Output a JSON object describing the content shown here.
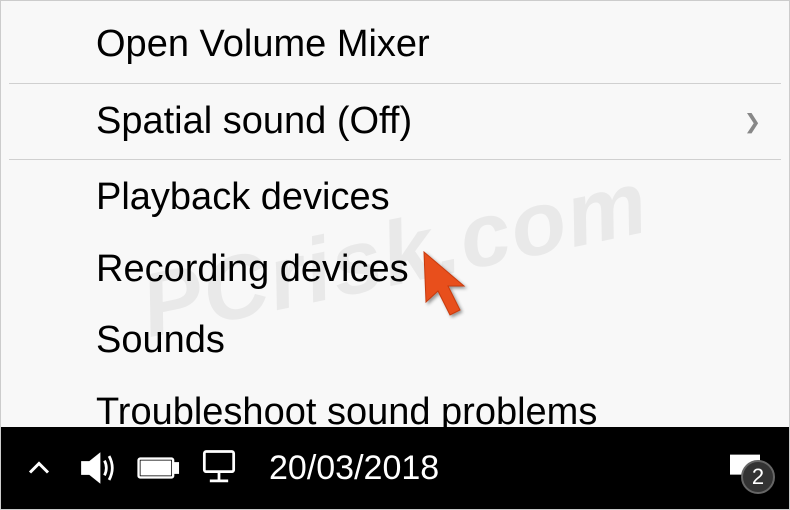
{
  "menu": {
    "items": [
      {
        "label": "Open Volume Mixer",
        "hasSubmenu": false
      },
      {
        "label": "Spatial sound (Off)",
        "hasSubmenu": true
      },
      {
        "label": "Playback devices",
        "hasSubmenu": false
      },
      {
        "label": "Recording devices",
        "hasSubmenu": false
      },
      {
        "label": "Sounds",
        "hasSubmenu": false
      },
      {
        "label": "Troubleshoot sound problems",
        "hasSubmenu": false
      }
    ]
  },
  "taskbar": {
    "date": "20/03/2018",
    "notification_count": "2"
  },
  "watermark": "PCrisk.com",
  "cursor_color": "#e8501f"
}
